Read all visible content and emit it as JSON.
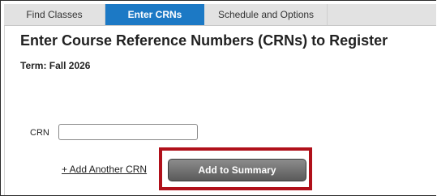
{
  "tabs": [
    {
      "label": "Find Classes",
      "active": false
    },
    {
      "label": "Enter CRNs",
      "active": true
    },
    {
      "label": "Schedule and Options",
      "active": false
    }
  ],
  "main": {
    "heading": "Enter Course Reference Numbers (CRNs) to Register",
    "term": "Term: Fall 2026",
    "crn_label": "CRN",
    "crn_value": "",
    "add_another_link": "+ Add Another CRN",
    "add_to_summary_button": "Add to Summary"
  },
  "colors": {
    "active_tab": "#1c79c5",
    "highlight_border": "#b0101a",
    "button_gray": "#6e6e6e"
  }
}
